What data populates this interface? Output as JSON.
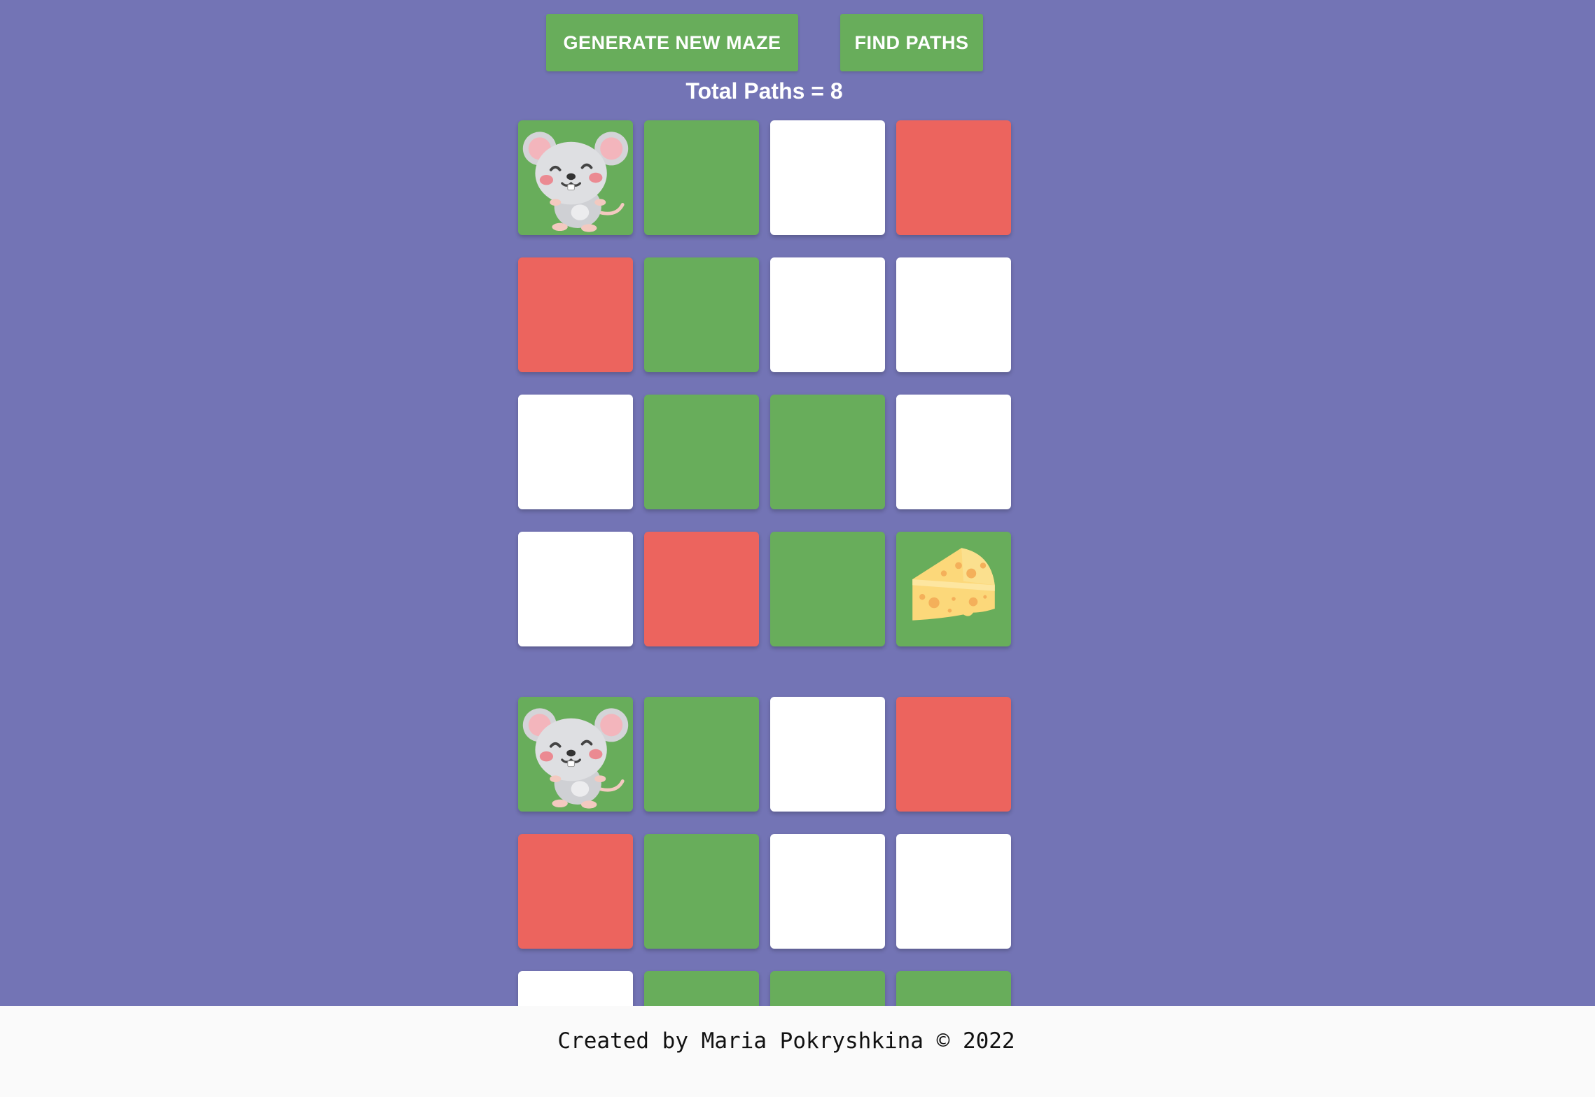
{
  "toolbar": {
    "generate_label": "GENERATE NEW MAZE",
    "find_label": "FIND PATHS"
  },
  "status": {
    "total_paths": "Total Paths = 8"
  },
  "colors": {
    "background": "#7374b5",
    "path": "#68ad5b",
    "wall": "#ec645e",
    "open": "#ffffff",
    "footer": "#fafafa"
  },
  "icons": {
    "start": "mouse-icon",
    "goal": "cheese-icon"
  },
  "mazes": [
    {
      "rows": [
        [
          "start",
          "path",
          "open",
          "wall"
        ],
        [
          "wall",
          "path",
          "open",
          "open"
        ],
        [
          "open",
          "path",
          "path",
          "open"
        ],
        [
          "open",
          "wall",
          "path",
          "goal"
        ]
      ]
    },
    {
      "rows": [
        [
          "start",
          "path",
          "open",
          "wall"
        ],
        [
          "wall",
          "path",
          "open",
          "open"
        ],
        [
          "open",
          "path",
          "path",
          "path"
        ]
      ]
    }
  ],
  "footer": {
    "credit": "Created by Maria Pokryshkina © 2022"
  }
}
